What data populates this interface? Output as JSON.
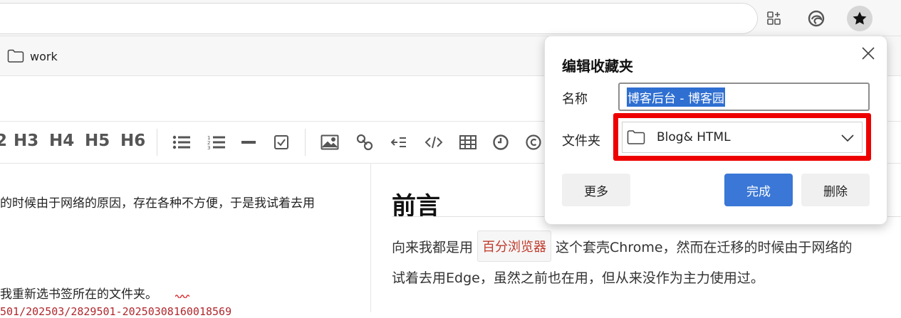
{
  "bookmarks_bar": {
    "items": [
      {
        "label": "work"
      }
    ]
  },
  "editor_toolbar": {
    "heading_buttons": [
      "2",
      "H3",
      "H4",
      "H5",
      "H6"
    ]
  },
  "editor": {
    "line1": "的时候由于网络的原因，存在各种不方便，于是我试着去用",
    "line2": "我重新选书签所在的文件夹。",
    "line3": "501/202503/2829501-20250308160018569"
  },
  "preview": {
    "title": "前言",
    "p1_before": "向来我都是用",
    "p1_badge": "百分浏览器",
    "p1_after": "这个套壳Chrome，然而在迁移的时候由于网络的",
    "p2": "试着去用Edge，虽然之前也在用，但从来没作为主力使用过。"
  },
  "favorites_popup": {
    "title": "编辑收藏夹",
    "name_label": "名称",
    "name_value": "博客后台 - 博客园",
    "folder_label": "文件夹",
    "folder_value": "Blog& HTML",
    "more_button": "更多",
    "done_button": "完成",
    "delete_button": "删除"
  },
  "colors": {
    "accent": "#3a77d6",
    "highlight_frame": "#ee0000",
    "code_text": "#b0272d"
  }
}
